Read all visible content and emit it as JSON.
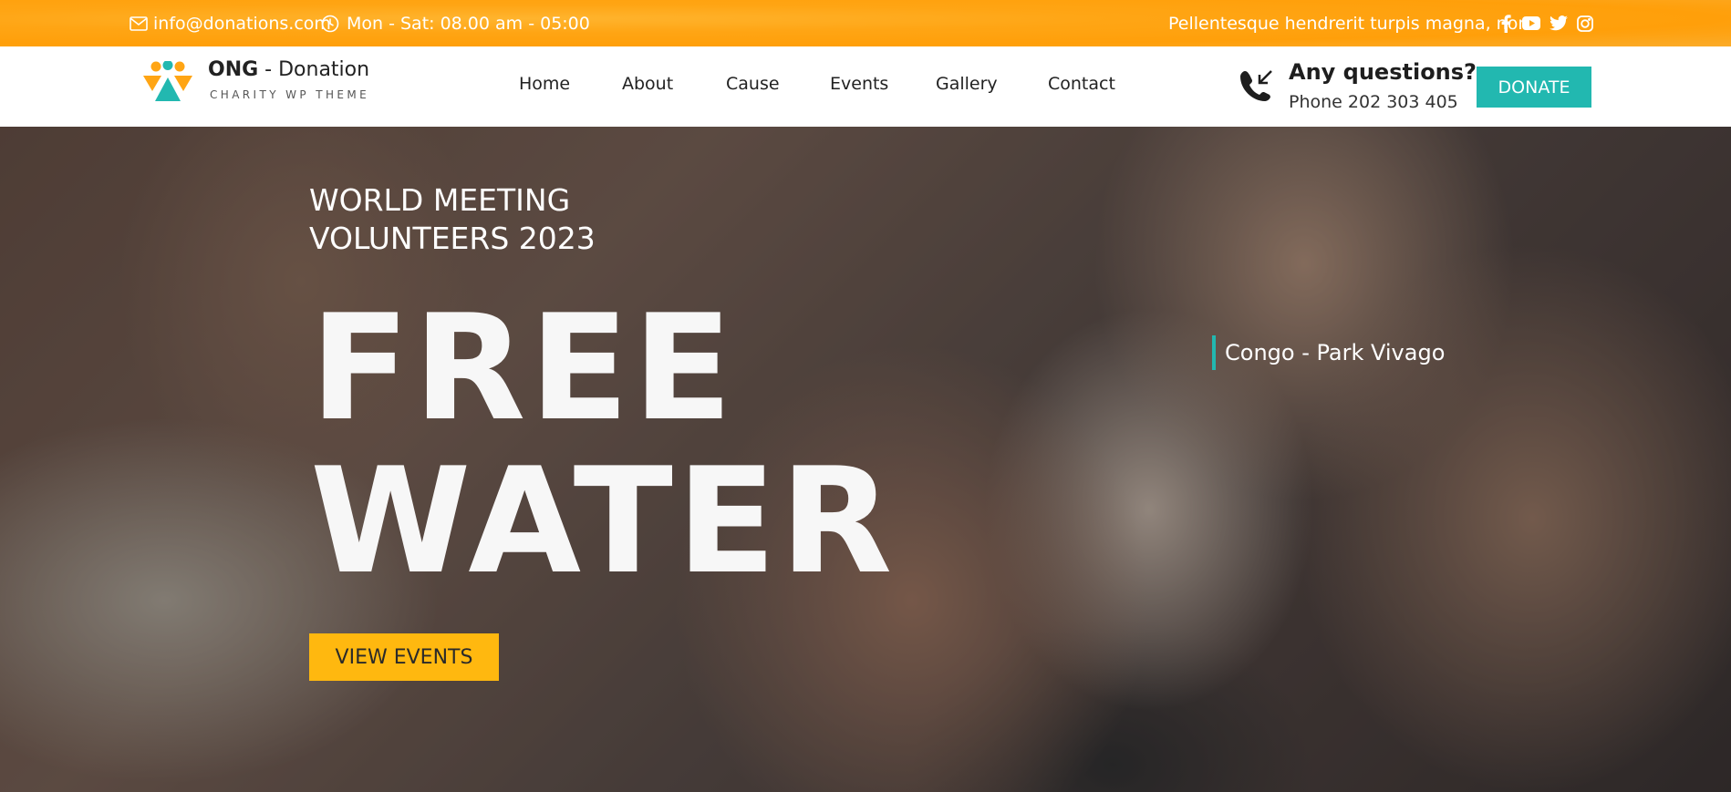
{
  "topbar": {
    "email": "info@donations.com",
    "hours": "Mon - Sat: 08.00 am - 05:00",
    "tagline": "Pellentesque hendrerit turpis magna, non",
    "social_icons": [
      "facebook-icon",
      "youtube-icon",
      "twitter-icon",
      "instagram-icon"
    ]
  },
  "header": {
    "logo": {
      "brand": "ONG",
      "separator": " - ",
      "name": "Donation",
      "subtitle": "CHARITY WP THEME"
    },
    "nav": [
      "Home",
      "About",
      "Cause",
      "Events",
      "Gallery",
      "Contact"
    ],
    "contact": {
      "title": "Any questions?",
      "phone": "Phone 202 303 405"
    },
    "donate_label": "DONATE"
  },
  "hero": {
    "subtitle": "WORLD MEETING VOLUNTEERS 2023",
    "title_line1": "FREE",
    "title_line2": "WATER",
    "cta_label": "VIEW EVENTS",
    "location": "Congo - Park Vivago"
  },
  "colors": {
    "topbar": "#ffa514",
    "accent_teal": "#22b8b0",
    "cta_yellow": "#ffb80f"
  }
}
